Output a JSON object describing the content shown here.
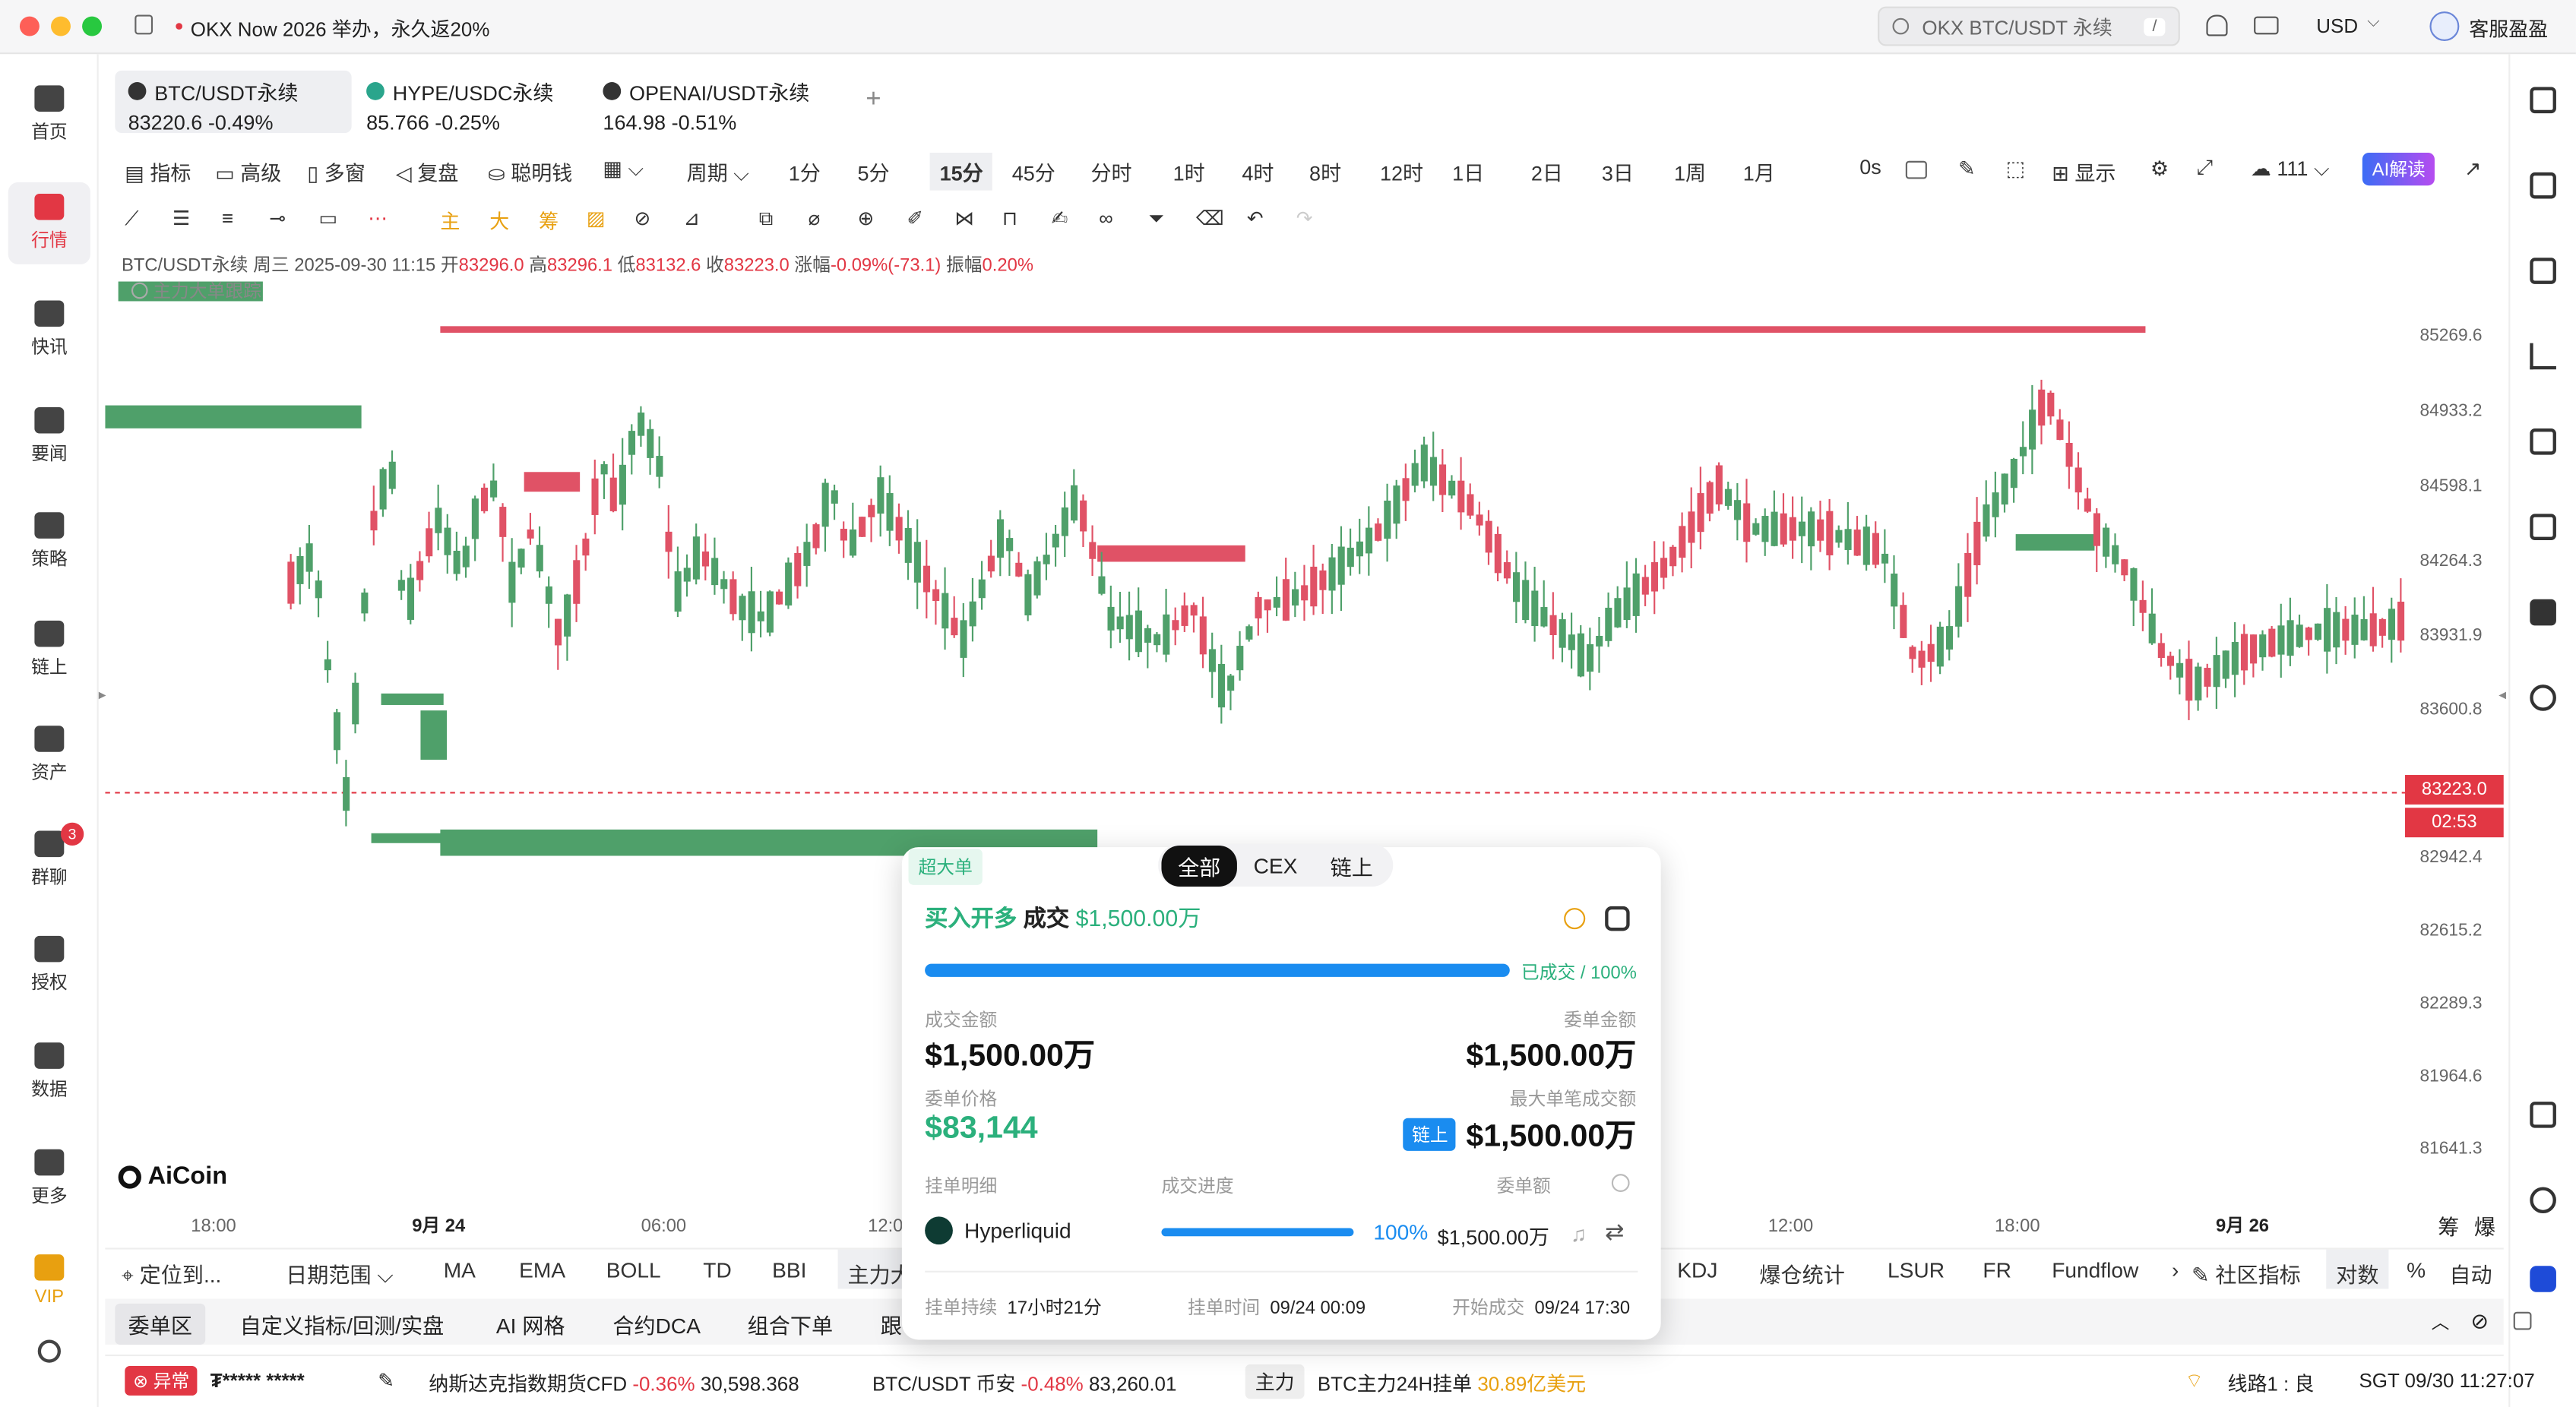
{
  "window": {
    "title": "OKX Now 2026 举办，永久返20%",
    "search_placeholder": "OKX BTC/USDT 永续",
    "search_shortcut": "/",
    "currency": "USD",
    "support": "客服盈盈"
  },
  "sidebar": {
    "items": [
      {
        "label": "首页",
        "icon": "home-icon"
      },
      {
        "label": "行情",
        "icon": "chart-bars-icon",
        "active": true
      },
      {
        "label": "快讯",
        "icon": "news-icon"
      },
      {
        "label": "要闻",
        "icon": "document-icon"
      },
      {
        "label": "策略",
        "icon": "robot-icon"
      },
      {
        "label": "链上",
        "icon": "chain-icon"
      },
      {
        "label": "资产",
        "icon": "wallet-icon"
      },
      {
        "label": "群聊",
        "icon": "chat-icon",
        "badge": "3"
      },
      {
        "label": "授权",
        "icon": "authorize-icon"
      },
      {
        "label": "数据",
        "icon": "data-icon"
      },
      {
        "label": "更多",
        "icon": "more-icon"
      },
      {
        "label": "VIP",
        "icon": "vip-icon"
      }
    ]
  },
  "tabs": [
    {
      "name": "BTC/USDT永续",
      "price": "83220.6",
      "change": "-0.49%"
    },
    {
      "name": "HYPE/USDC永续",
      "price": "85.766",
      "change": "-0.25%"
    },
    {
      "name": "OPENAI/USDT永续",
      "price": "164.98",
      "change": "-0.51%"
    }
  ],
  "toolbar1": {
    "left": [
      "指标",
      "高级",
      "多窗",
      "复盘",
      "聪明钱"
    ],
    "period_label": "周期",
    "periods": [
      "1分",
      "5分",
      "15分",
      "45分",
      "分时",
      "1时",
      "4时",
      "8时",
      "12时",
      "1日",
      "2日",
      "3日",
      "1周",
      "1月"
    ],
    "active_period": "15分",
    "countdown": "0s",
    "display": "显示",
    "cloud_count": "111",
    "ai_button": "AI解读"
  },
  "toolbar2": {
    "tags": [
      "主",
      "大",
      "筹"
    ]
  },
  "ohlc": {
    "symbol": "BTC/USDT永续",
    "weekday": "周三",
    "datetime": "2025-09-30 11:15",
    "open_label": "开",
    "open": "83296.0",
    "high_label": "高",
    "high": "83296.1",
    "low_label": "低",
    "low": "83132.6",
    "close_label": "收",
    "close": "83223.0",
    "change_label": "涨幅",
    "change": "-0.09%(-73.1)",
    "amp_label": "振幅",
    "amp": "0.20%",
    "indicator": "主力大单跟踪"
  },
  "chart_data": {
    "type": "candlestick",
    "y_ticks": [
      "85269.6",
      "84933.2",
      "84598.1",
      "84264.3",
      "83931.9",
      "83600.8",
      "83223.0",
      "82942.4",
      "82615.2",
      "82289.3",
      "81964.6",
      "81641.3"
    ],
    "x_ticks": [
      "18:00",
      "9月 24",
      "06:00",
      "12:0",
      "12:00",
      "18:00",
      "9月 26"
    ],
    "last_price": "83223.0",
    "countdown": "02:53",
    "ylim": [
      81500,
      85500
    ],
    "watermark": "AiCoin"
  },
  "popup": {
    "badge": "超大单",
    "tabs": [
      "全部",
      "CEX",
      "链上"
    ],
    "active_tab": "全部",
    "headline_side": "买入开多",
    "headline_word": "成交",
    "headline_amount": "$1,500.00万",
    "progress": 1.0,
    "progress_text": "已成交 / 100%",
    "filled_label": "成交金额",
    "filled_value": "$1,500.00万",
    "order_label": "委单金额",
    "order_value": "$1,500.00万",
    "price_label": "委单价格",
    "price_value": "$83,144",
    "max_label": "最大单笔成交额",
    "max_tag": "链上",
    "max_value": "$1,500.00万",
    "col1": "挂单明细",
    "col2": "成交进度",
    "col3": "委单额",
    "exchange": "Hyperliquid",
    "ex_progress": "100%",
    "ex_amount": "$1,500.00万",
    "dur_label": "挂单持续",
    "dur_value": "17小时21分",
    "placed_label": "挂单时间",
    "placed_value": "09/24 00:09",
    "start_label": "开始成交",
    "start_value": "09/24 17:30"
  },
  "bottombar": {
    "locate": "定位到...",
    "range": "日期范围",
    "items": [
      "MA",
      "EMA",
      "BOLL",
      "TD",
      "BBI",
      "主力大"
    ],
    "right": [
      "KDJ",
      "爆仓统计",
      "LSUR",
      "FR",
      "Fundflow"
    ],
    "community": "社区指标",
    "pair": "对数",
    "pct": "%",
    "auto": "自动",
    "chips": "筹",
    "burst": "爆"
  },
  "bottombar2": {
    "items": [
      "委单区",
      "自定义指标/回测/实盘",
      "AI 网格",
      "合约DCA",
      "组合下单",
      "跟"
    ]
  },
  "statusbar": {
    "alert": "异常",
    "masked": "₮*****  *****",
    "items": [
      {
        "name": "纳斯达克指数期货CFD",
        "change": "-0.36%",
        "price": "30,598.368"
      },
      {
        "name": "BTC/USDT 币安",
        "change": "-0.48%",
        "price": "83,260.01"
      }
    ],
    "main_tag": "主力",
    "main_text": "BTC主力24H挂单",
    "main_value": "30.89亿美元",
    "line": "线路1 : 良",
    "time": "SGT 09/30 11:27:07"
  }
}
